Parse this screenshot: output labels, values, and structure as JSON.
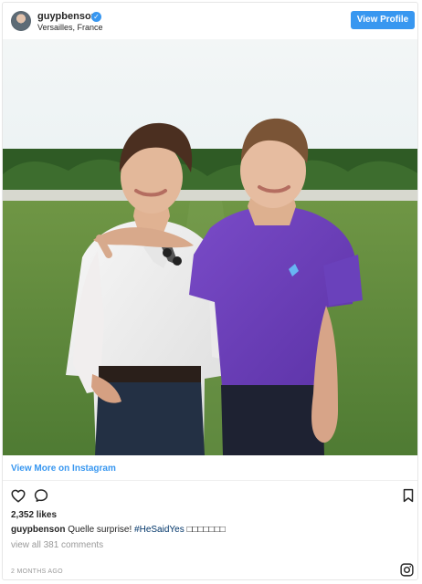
{
  "post": {
    "username": "guypbenson",
    "verified_icon": "verified-badge-icon",
    "location": "Versailles, France",
    "view_profile_label": "View Profile",
    "photo_icon": "photo-two-men-versailles",
    "view_more_label": "View More on Instagram",
    "likes": "2,352 likes",
    "caption_user": "guypbenson",
    "caption_text": "Quelle surprise!",
    "caption_hashtag": "#HeSaidYes",
    "caption_emoji": "□□□□□□□",
    "comments_link": "view all 381 comments",
    "timestamp": "2 MONTHS AGO"
  },
  "colors": {
    "accent": "#3897f0",
    "text": "#262626",
    "muted": "#999999",
    "hashtag": "#003569"
  },
  "icons": {
    "like": "heart-icon",
    "comment": "comment-icon",
    "save": "bookmark-icon",
    "brand": "instagram-icon"
  }
}
